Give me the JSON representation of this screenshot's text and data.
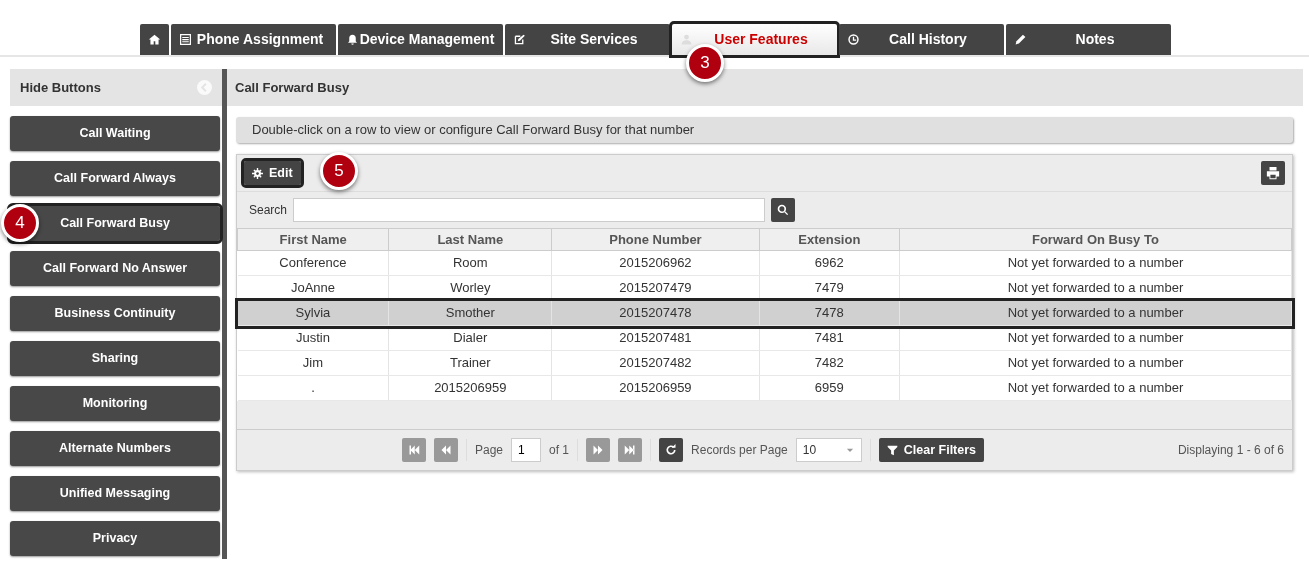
{
  "tabs": [
    {
      "kind": "home",
      "selected": false,
      "highlighted": false
    },
    {
      "kind": "list",
      "label": "Phone Assignment",
      "selected": false,
      "highlighted": false
    },
    {
      "kind": "bell",
      "label": "Device Management",
      "selected": false,
      "highlighted": false
    },
    {
      "kind": "edit",
      "label": "Site Services",
      "selected": false,
      "highlighted": false
    },
    {
      "kind": "user",
      "label": "User Features",
      "selected": true,
      "highlighted": true,
      "callout": "3"
    },
    {
      "kind": "clock",
      "label": "Call History",
      "selected": false,
      "highlighted": false
    },
    {
      "kind": "pencil",
      "label": "Notes",
      "selected": false,
      "highlighted": false
    }
  ],
  "sidebar": {
    "title": "Hide Buttons",
    "items": [
      {
        "label": "Call Waiting",
        "highlighted": false
      },
      {
        "label": "Call Forward Always",
        "highlighted": false
      },
      {
        "label": "Call Forward Busy",
        "highlighted": true,
        "callout": "4"
      },
      {
        "label": "Call Forward No Answer",
        "highlighted": false
      },
      {
        "label": "Business Continuity",
        "highlighted": false
      },
      {
        "label": "Sharing",
        "highlighted": false
      },
      {
        "label": "Monitoring",
        "highlighted": false
      },
      {
        "label": "Alternate Numbers",
        "highlighted": false
      },
      {
        "label": "Unified Messaging",
        "highlighted": false
      },
      {
        "label": "Privacy",
        "highlighted": false
      }
    ]
  },
  "panel": {
    "title": "Call Forward Busy",
    "info": "Double-click on a row to view or configure Call Forward Busy for that number"
  },
  "toolbar": {
    "edit_button": {
      "label": "Edit",
      "highlighted": true,
      "callout": "5"
    }
  },
  "search": {
    "label": "Search"
  },
  "table": {
    "columns": [
      "First Name",
      "Last Name",
      "Phone Number",
      "Extension",
      "Forward On Busy To"
    ],
    "rows": [
      {
        "cells": [
          "Conference",
          "Room",
          "2015206962",
          "6962",
          "Not yet forwarded to a number"
        ],
        "selected": false,
        "highlighted": false
      },
      {
        "cells": [
          "JoAnne",
          "Worley",
          "2015207479",
          "7479",
          "Not yet forwarded to a number"
        ],
        "selected": false,
        "highlighted": false
      },
      {
        "cells": [
          "Sylvia",
          "Smother",
          "2015207478",
          "7478",
          "Not yet forwarded to a number"
        ],
        "selected": true,
        "highlighted": true
      },
      {
        "cells": [
          "Justin",
          "Dialer",
          "2015207481",
          "7481",
          "Not yet forwarded to a number"
        ],
        "selected": false,
        "highlighted": false
      },
      {
        "cells": [
          "Jim",
          "Trainer",
          "2015207482",
          "7482",
          "Not yet forwarded to a number"
        ],
        "selected": false,
        "highlighted": false
      },
      {
        "cells": [
          ".",
          "2015206959",
          "2015206959",
          "6959",
          "Not yet forwarded to a number"
        ],
        "selected": false,
        "highlighted": false
      }
    ]
  },
  "pager": {
    "page_label": "Page",
    "page": "1",
    "of": "of 1",
    "records_label": "Records per Page",
    "records": "10",
    "clear_filters": "Clear Filters",
    "displaying": "Displaying 1 - 6 of 6"
  }
}
